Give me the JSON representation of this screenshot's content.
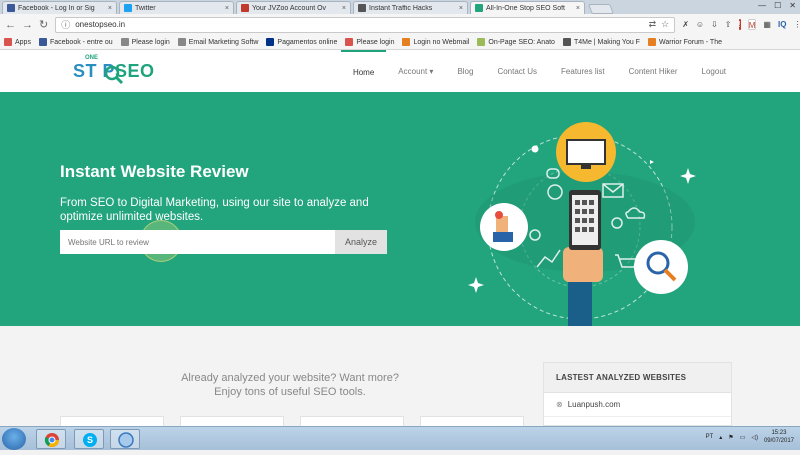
{
  "browser": {
    "tabs": [
      {
        "label": "Facebook - Log In or Sig",
        "favicon_color": "#3b5998",
        "active": false
      },
      {
        "label": "Twitter",
        "favicon_color": "#1da1f2",
        "active": false
      },
      {
        "label": "Your JVZoo Account Ov",
        "favicon_color": "#c0392b",
        "active": false
      },
      {
        "label": "Instant Traffic Hacks",
        "favicon_color": "#555555",
        "active": false
      },
      {
        "label": "All-In-One Stop SEO Soft",
        "favicon_color": "#22a47d",
        "active": true
      }
    ],
    "tab_close_glyph": "×",
    "url": "onestopseo.in",
    "bookmarks": [
      {
        "label": "Apps",
        "icon_color": "#d9534f"
      },
      {
        "label": "Facebook - entre ou",
        "icon_color": "#3b5998"
      },
      {
        "label": "Please login",
        "icon_color": "#888888"
      },
      {
        "label": "Email Marketing Softw",
        "icon_color": "#888888"
      },
      {
        "label": "Pagamentos online",
        "icon_color": "#003087"
      },
      {
        "label": "Please login",
        "icon_color": "#d9534f"
      },
      {
        "label": "Login no Webmail",
        "icon_color": "#e67e22"
      },
      {
        "label": "On-Page SEO: Anato",
        "icon_color": "#9bbb59"
      },
      {
        "label": "T4Me | Making You F",
        "icon_color": "#555555"
      },
      {
        "label": "Warrior Forum - The",
        "icon_color": "#e67e22"
      }
    ]
  },
  "site": {
    "logo": {
      "one": "ONE",
      "stop": "ST P",
      "seo": "SEO"
    },
    "nav": [
      {
        "label": "Home",
        "active": true
      },
      {
        "label": "Account ▾",
        "active": false
      },
      {
        "label": "Blog",
        "active": false
      },
      {
        "label": "Contact Us",
        "active": false
      },
      {
        "label": "Features list",
        "active": false
      },
      {
        "label": "Content Hiker",
        "active": false
      },
      {
        "label": "Logout",
        "active": false
      }
    ],
    "hero": {
      "title": "Instant Website Review",
      "subtitle": "From SEO to Digital Marketing, using our site to analyze and optimize unlimited websites.",
      "search_placeholder": "Website URL to review",
      "analyze_label": "Analyze"
    },
    "promo": {
      "line1": "Already analyzed your website? Want more?",
      "line2": "Enjoy tons of useful SEO tools."
    },
    "latest_panel": {
      "title": "LASTEST ANALYZED WEBSITES",
      "items": [
        "Luanpush.com"
      ]
    }
  },
  "taskbar": {
    "lang": "PT",
    "time": "15:23",
    "date": "09/07/2017"
  },
  "colors": {
    "brand_green": "#22a47d",
    "brand_blue": "#2a8ec0"
  }
}
